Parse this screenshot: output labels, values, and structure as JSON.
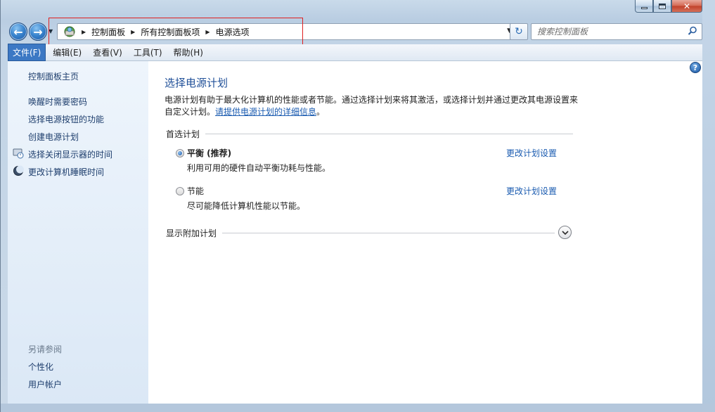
{
  "window": {
    "caption_buttons": {
      "minimize_icon": "minimize-icon",
      "maximize_icon": "maximize-icon",
      "close_icon": "close-icon"
    }
  },
  "navbar": {
    "back_icon": "back-arrow-icon",
    "forward_icon": "forward-arrow-icon",
    "breadcrumb": [
      "控制面板",
      "所有控制面板项",
      "电源选项"
    ],
    "search_placeholder": "搜索控制面板"
  },
  "menubar": {
    "items": [
      "文件(F)",
      "编辑(E)",
      "查看(V)",
      "工具(T)",
      "帮助(H)"
    ],
    "active_index": 0
  },
  "left_pane": {
    "home_link": "控制面板主页",
    "links": [
      "唤醒时需要密码",
      "选择电源按钮的功能",
      "创建电源计划",
      "选择关闭显示器的时间",
      "更改计算机睡眠时间"
    ],
    "see_also_title": "另请参阅",
    "see_also": [
      "个性化",
      "用户帐户"
    ]
  },
  "main": {
    "title": "选择电源计划",
    "description": "电源计划有助于最大化计算机的性能或者节能。通过选择计划来将其激活，或选择计划并通过更改其电源设置来自定义计划。",
    "description_link": "请提供电源计划的详细信息",
    "description_end": "。",
    "preferred_header": "首选计划",
    "plans": [
      {
        "name": "平衡 (推荐)",
        "desc": "利用可用的硬件自动平衡功耗与性能。",
        "link": "更改计划设置",
        "selected": true
      },
      {
        "name": "节能",
        "desc": "尽可能降低计算机性能以节能。",
        "link": "更改计划设置",
        "selected": false
      }
    ],
    "additional_header": "显示附加计划",
    "colors": {
      "title": "#1f4f98",
      "link": "#1a5bb0",
      "annotation_box": "#e02020"
    }
  }
}
